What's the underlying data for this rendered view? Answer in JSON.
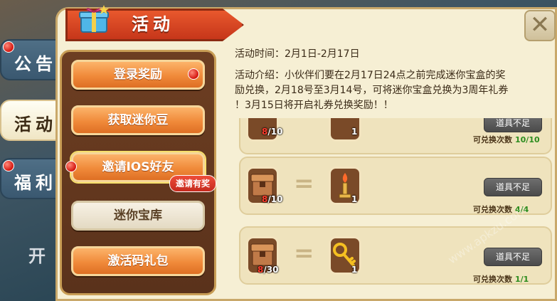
{
  "sidebar": {
    "tabs": [
      {
        "label": "公告"
      },
      {
        "label": "活动"
      },
      {
        "label": "福利"
      },
      {
        "label": "开"
      }
    ]
  },
  "panel": {
    "title": "活动",
    "close_label": "✕"
  },
  "menu": {
    "items": [
      {
        "label": "登录奖励"
      },
      {
        "label": "获取迷你豆"
      },
      {
        "label": "邀请IOS好友"
      },
      {
        "label": "迷你宝库"
      },
      {
        "label": "激活码礼包"
      }
    ],
    "invite_tag": "邀请有奖"
  },
  "info": {
    "time": "活动时间：2月1日-2月17日",
    "desc_line1": "活动介绍：小伙伴们要在2月17日24点之前完成迷你宝盒的奖",
    "desc_line2": "励兑换，2月18号至3月14号，可将迷你宝盒兑换为3周年礼券",
    "desc_line3": "！3月15日将开启礼券兑换奖励！！"
  },
  "rows": [
    {
      "cost": "/10",
      "reward_count": "1",
      "button": "道具不足",
      "exchange_label": "可兑换次数",
      "exchange_value": "10/10"
    },
    {
      "cost": "/10",
      "reward_count": "1",
      "button": "道具不足",
      "exchange_label": "可兑换次数",
      "exchange_value": "4/4"
    },
    {
      "cost": "/30",
      "reward_count": "1",
      "button": "道具不足",
      "exchange_label": "可兑换次数",
      "exchange_value": "1/1"
    }
  ],
  "watermark": "www.apkzu.com",
  "colors": {
    "accent": "#e8582d",
    "panel": "#f6efd4",
    "menu": "#6d3e22",
    "button_orange": "#f08a3a"
  }
}
